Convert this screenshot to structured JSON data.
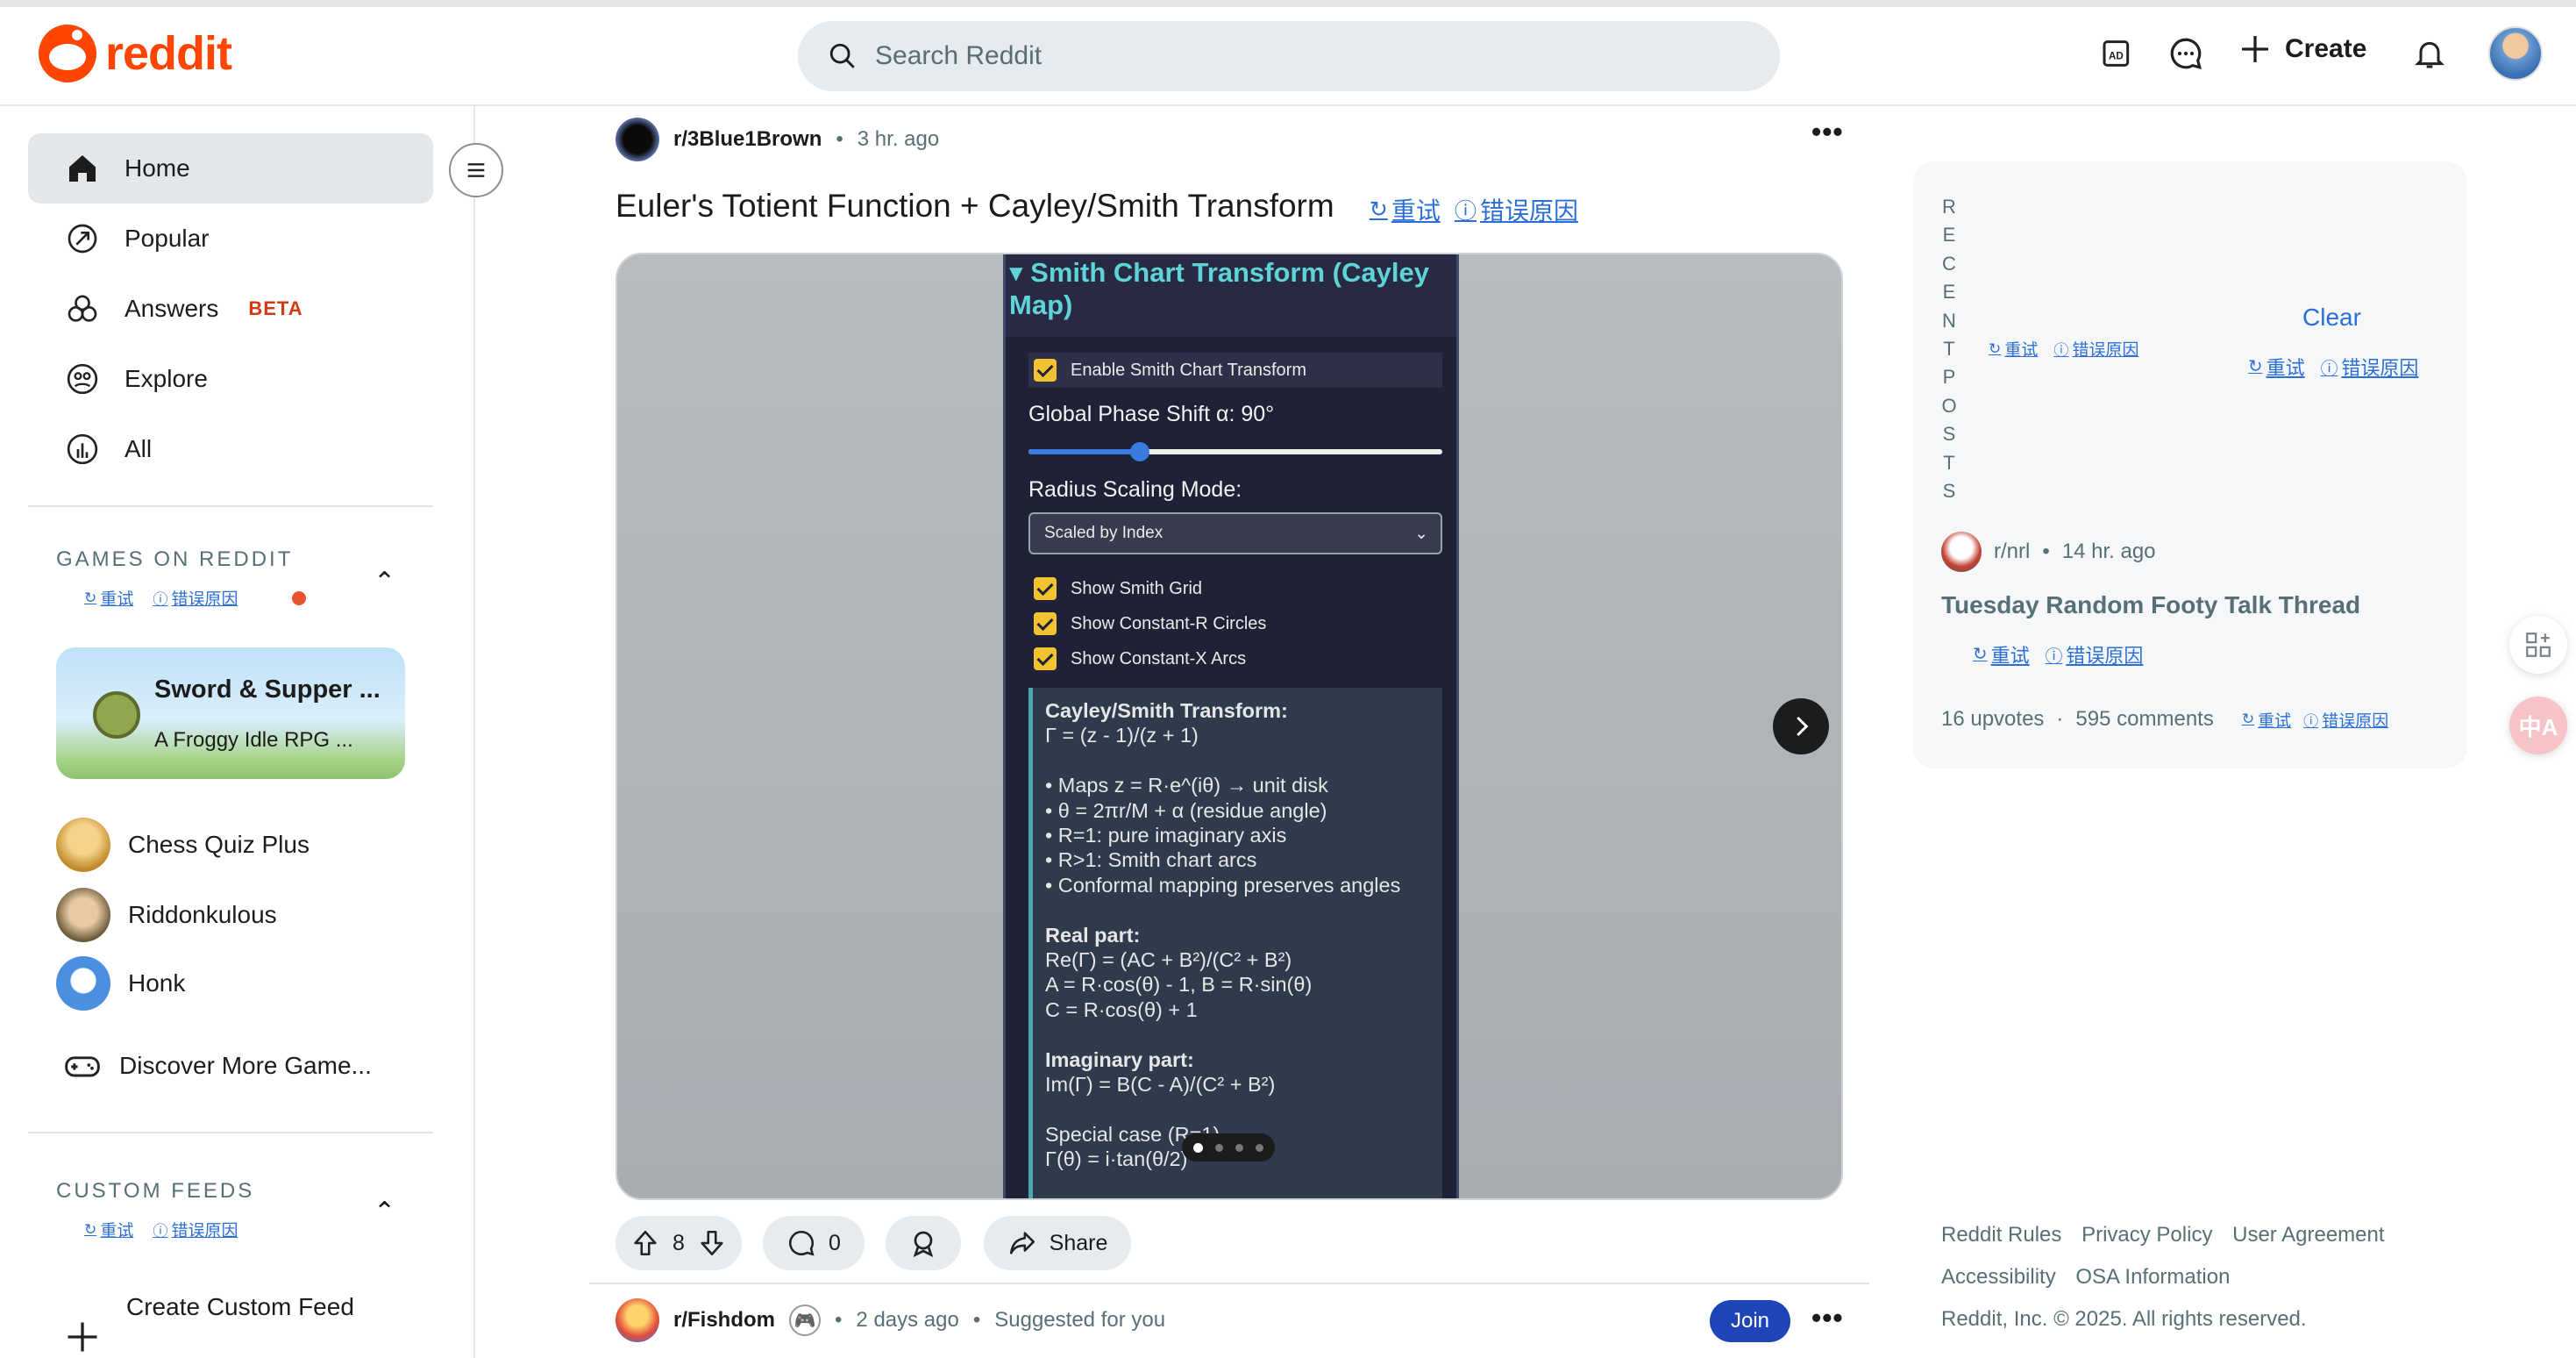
{
  "header": {
    "logo_text": "reddit",
    "search_placeholder": "Search Reddit",
    "create_label": "Create",
    "icons": [
      "ad-icon",
      "chat-icon",
      "plus-icon",
      "bell-icon",
      "avatar"
    ]
  },
  "sidebar": {
    "nav": [
      {
        "label": "Home",
        "icon": "home-icon"
      },
      {
        "label": "Popular",
        "icon": "popular-icon"
      },
      {
        "label": "Answers",
        "badge": "BETA",
        "icon": "answers-icon"
      },
      {
        "label": "Explore",
        "icon": "explore-icon"
      },
      {
        "label": "All",
        "icon": "all-icon"
      }
    ],
    "games_title": "GAMES ON REDDIT",
    "featured_game": {
      "title": "Sword & Supper ...",
      "subtitle": "A Froggy Idle RPG ..."
    },
    "games": [
      "Chess Quiz Plus",
      "Riddonkulous",
      "Honk"
    ],
    "discover": "Discover More Game...",
    "custom_feeds_title": "CUSTOM FEEDS",
    "create_feed": "Create Custom Feed"
  },
  "translate": {
    "retry": "重试",
    "error_reason": "错误原因"
  },
  "post": {
    "subreddit": "r/3Blue1Brown",
    "time": "3 hr. ago",
    "title": "Euler's Totient Function + Cayley/Smith Transform",
    "panel": {
      "heading": "▾ Smith Chart Transform (Cayley Map)",
      "enable": "Enable Smith Chart Transform",
      "phase_label": "Global Phase Shift α: 90°",
      "phase_value": 0.27,
      "radius_label": "Radius Scaling Mode:",
      "radius_value": "Scaled by Index",
      "checks": [
        "Show Smith Grid",
        "Show Constant-R Circles",
        "Show Constant-X Arcs"
      ],
      "info_lines": [
        {
          "t": "Cayley/Smith Transform:",
          "b": true
        },
        {
          "t": "Γ = (z - 1)/(z + 1)"
        },
        {
          "t": ""
        },
        {
          "t": "• Maps z = R·e^(iθ) → unit disk"
        },
        {
          "t": "• θ = 2πr/M + α (residue angle)"
        },
        {
          "t": "• R=1: pure imaginary axis"
        },
        {
          "t": "• R>1: Smith chart arcs"
        },
        {
          "t": "• Conformal mapping preserves angles"
        },
        {
          "t": ""
        },
        {
          "t": "Real part:",
          "b": true
        },
        {
          "t": "Re(Γ) = (AC + B²)/(C² + B²)"
        },
        {
          "t": "A = R·cos(θ) - 1, B = R·sin(θ)"
        },
        {
          "t": "C = R·cos(θ) + 1"
        },
        {
          "t": ""
        },
        {
          "t": "Imaginary part:",
          "b": true
        },
        {
          "t": "Im(Γ) = B(C - A)/(C² + B²)"
        },
        {
          "t": ""
        },
        {
          "t": "Special case (R=1)"
        },
        {
          "t": "Γ(θ) = i·tan(θ/2)"
        }
      ]
    },
    "upvotes": "8",
    "comments": "0",
    "share": "Share"
  },
  "next_post": {
    "subreddit": "r/Fishdom",
    "time": "2 days ago",
    "suggested": "Suggested for you",
    "join": "Join"
  },
  "recent": {
    "title": "RECENT POSTS",
    "clear": "Clear",
    "post": {
      "subreddit": "r/nrl",
      "time": "14 hr. ago",
      "title": "Tuesday Random Footy Talk Thread",
      "upvotes": "16 upvotes",
      "comments": "595 comments"
    }
  },
  "footer": {
    "links": [
      "Reddit Rules",
      "Privacy Policy",
      "User Agreement",
      "Accessibility",
      "OSA Information"
    ],
    "copyright": "Reddit, Inc. © 2025. All rights reserved."
  }
}
